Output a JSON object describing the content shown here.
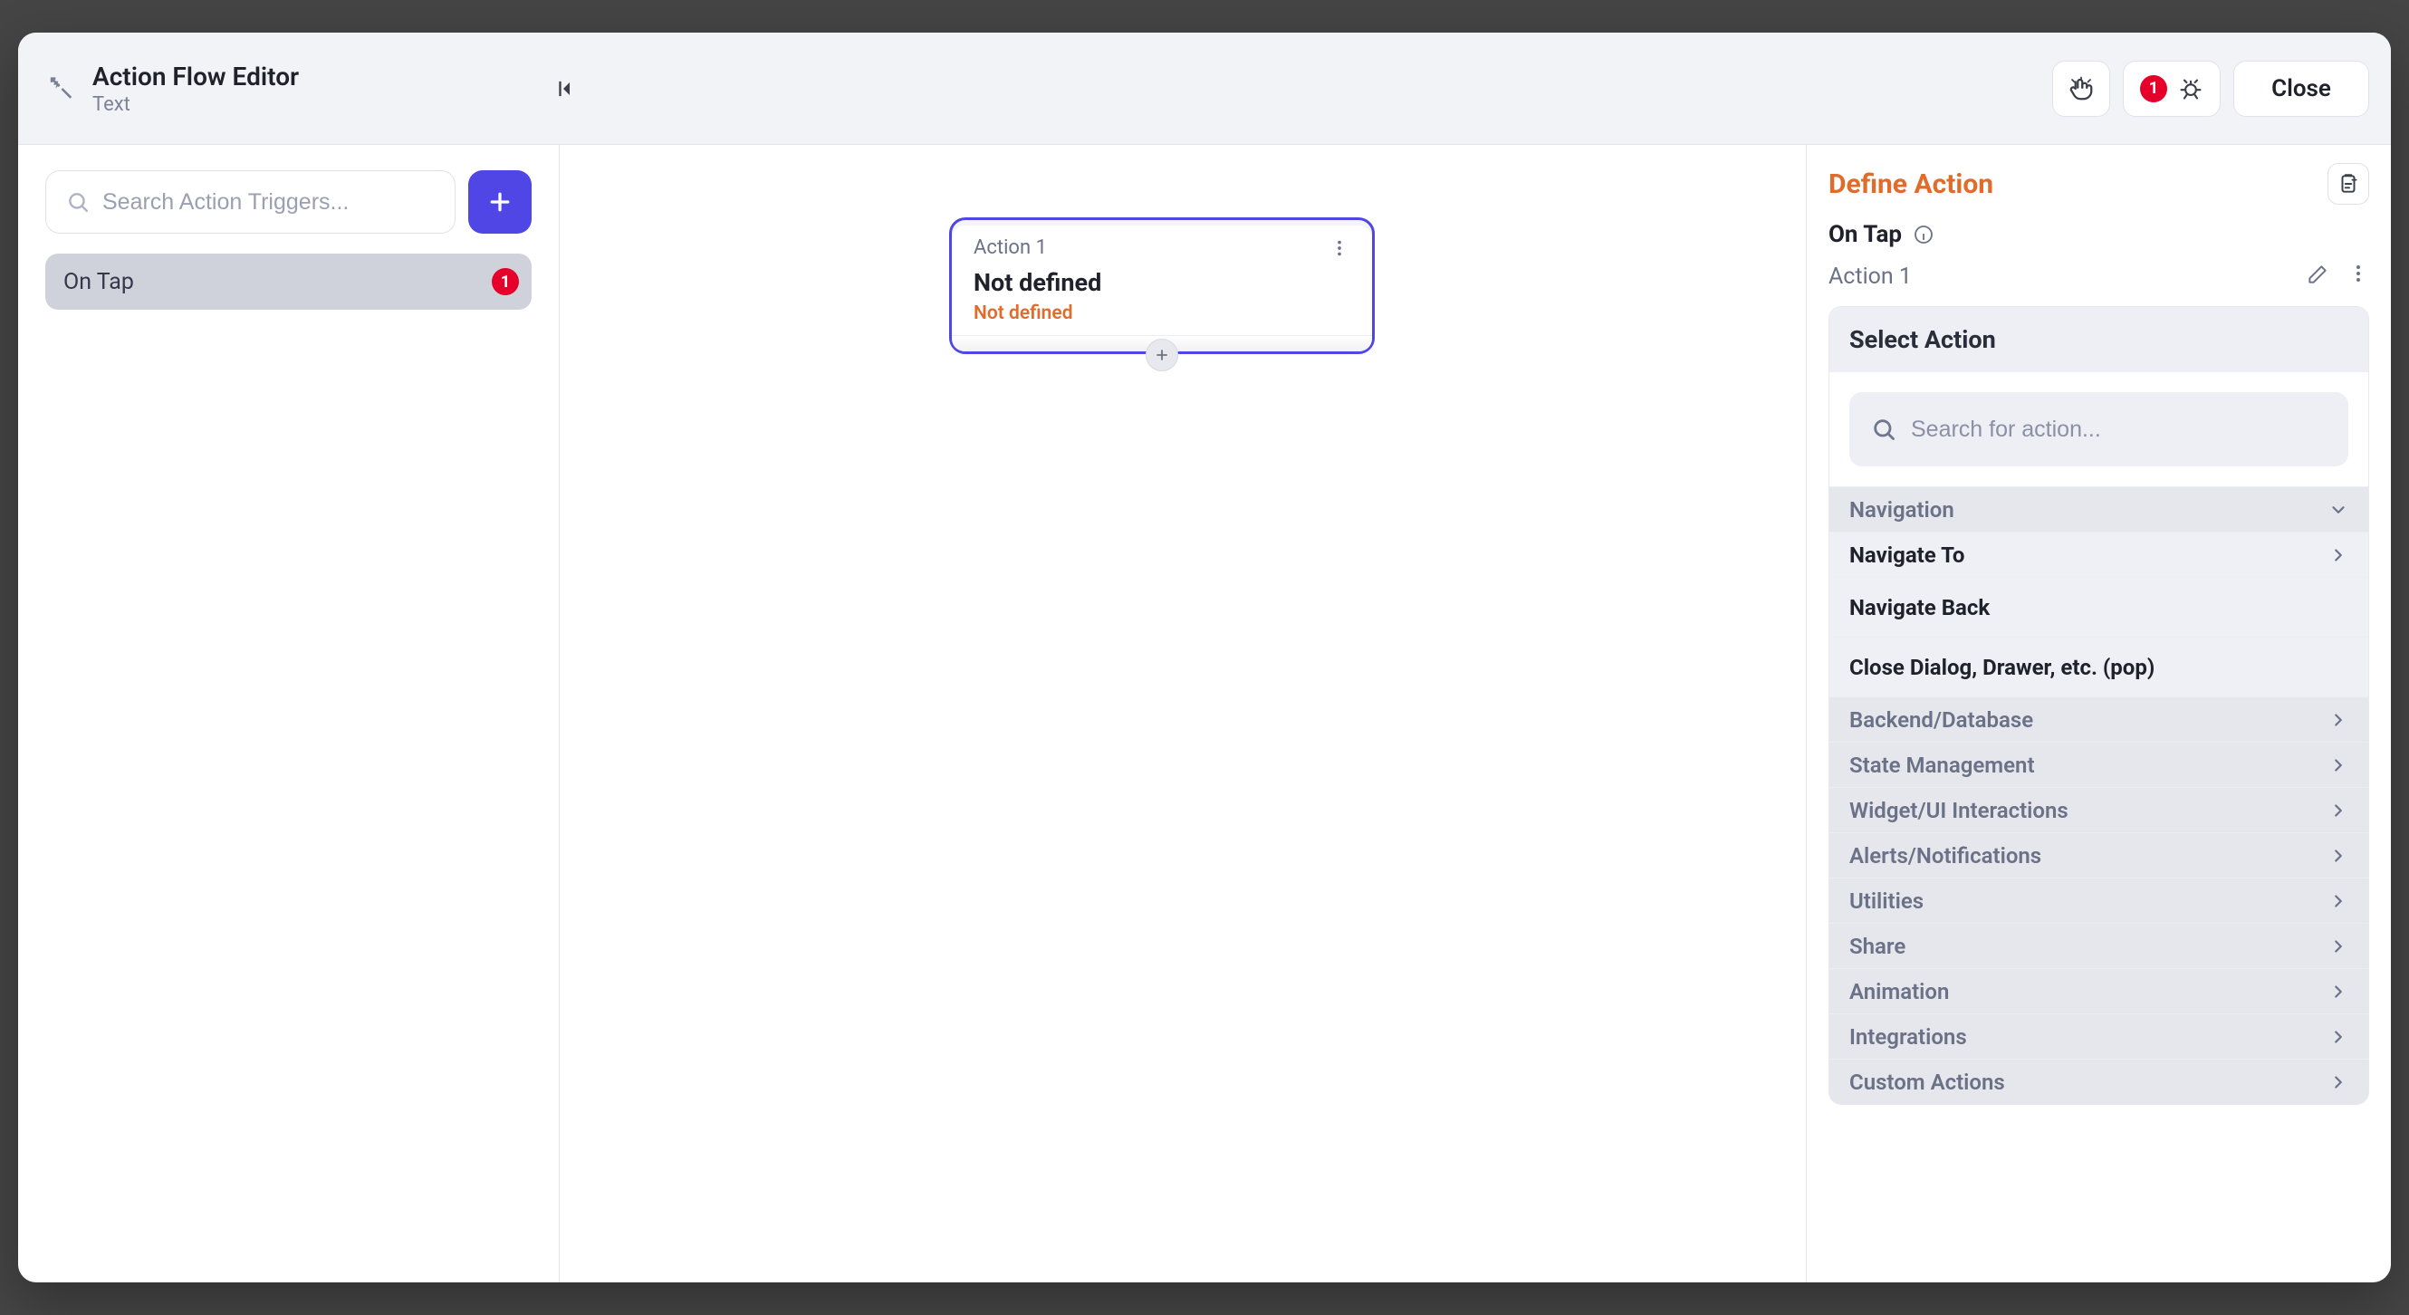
{
  "header": {
    "title": "Action Flow Editor",
    "subtitle": "Text",
    "debug_badge": "1",
    "close_label": "Close"
  },
  "sidebar": {
    "search_placeholder": "Search Action Triggers...",
    "triggers": [
      {
        "label": "On Tap",
        "badge": "1"
      }
    ]
  },
  "canvas": {
    "node": {
      "head_label": "Action 1",
      "title": "Not defined",
      "subtitle": "Not defined"
    }
  },
  "rightPanel": {
    "title": "Define Action",
    "trigger_label": "On Tap",
    "action_name": "Action 1",
    "select_action": {
      "title": "Select Action",
      "search_placeholder": "Search for action...",
      "groups": [
        {
          "name": "Navigation",
          "expanded": true,
          "items": [
            {
              "label": "Navigate To",
              "chevron": true
            },
            {
              "label": "Navigate Back",
              "chevron": false
            },
            {
              "label": "Close Dialog, Drawer, etc. (pop)",
              "chevron": false
            }
          ]
        },
        {
          "name": "Backend/Database",
          "expanded": false
        },
        {
          "name": "State Management",
          "expanded": false
        },
        {
          "name": "Widget/UI Interactions",
          "expanded": false
        },
        {
          "name": "Alerts/Notifications",
          "expanded": false
        },
        {
          "name": "Utilities",
          "expanded": false
        },
        {
          "name": "Share",
          "expanded": false
        },
        {
          "name": "Animation",
          "expanded": false
        },
        {
          "name": "Integrations",
          "expanded": false
        },
        {
          "name": "Custom Actions",
          "expanded": false
        }
      ]
    }
  }
}
